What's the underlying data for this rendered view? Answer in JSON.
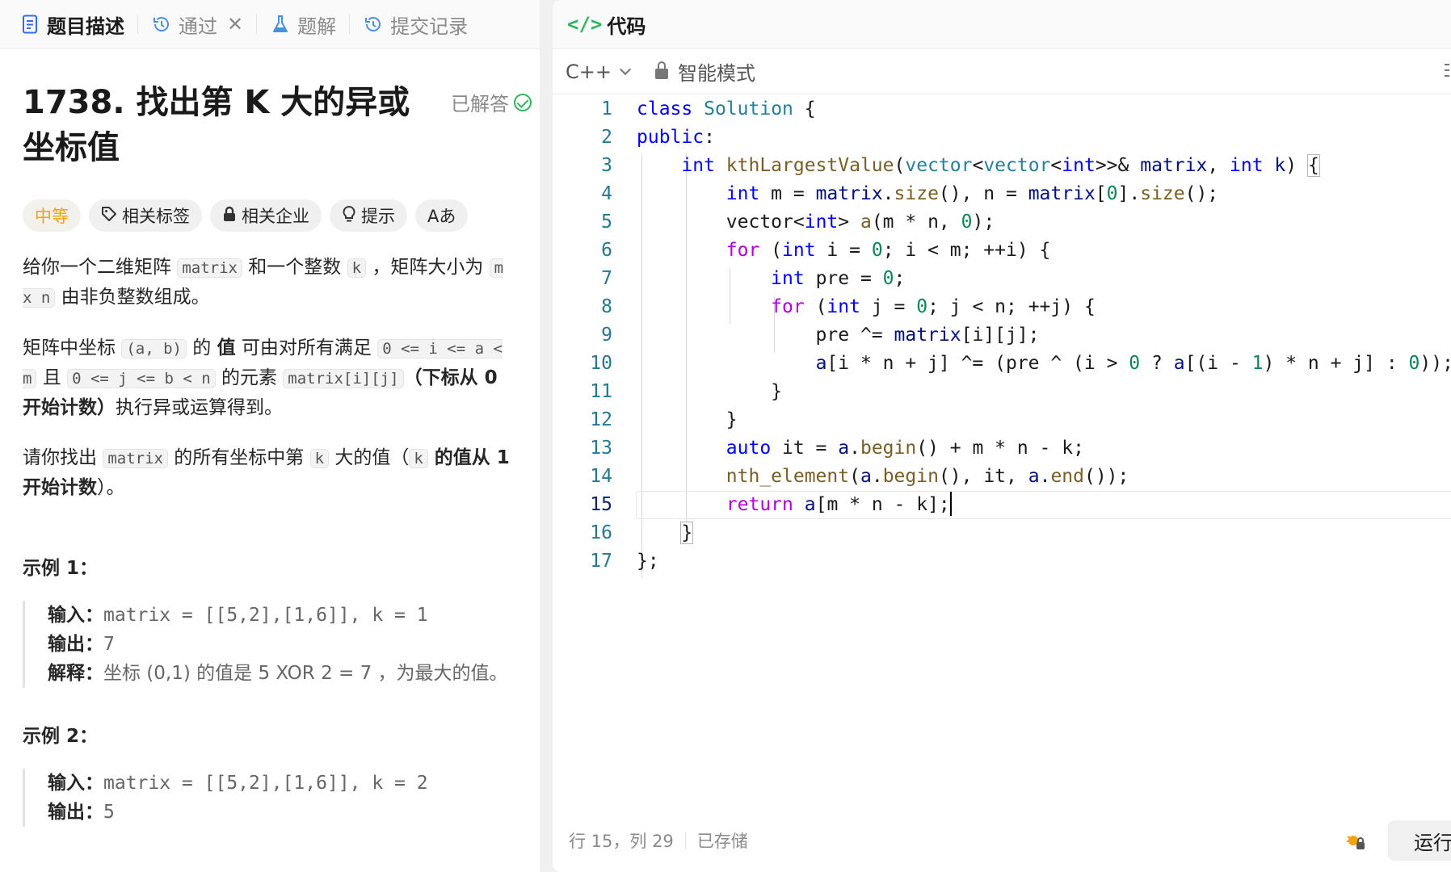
{
  "left_tabs": {
    "description": "题目描述",
    "accepted": "通过",
    "solutions": "题解",
    "submissions": "提交记录"
  },
  "problem": {
    "title": "1738. 找出第 K 大的异或坐标值",
    "status": "已解答",
    "tags": {
      "difficulty": "中等",
      "related_tags": "相关标签",
      "companies": "相关企业",
      "hint": "提示",
      "font": "Aあ"
    },
    "p1": {
      "t1": "给你一个二维矩阵 ",
      "c1": "matrix",
      "t2": " 和一个整数 ",
      "c2": "k",
      "t3": " ，矩阵大小为 ",
      "c3": "m x n",
      "t4": " 由非负整数组成。"
    },
    "p2": {
      "t1": "矩阵中坐标 ",
      "c1": "(a, b)",
      "t2": " 的 ",
      "b1": "值",
      "t3": " 可由对所有满足 ",
      "c2": "0 <= i <= a < m",
      "t4": " 且 ",
      "c3": "0 <= j <= b < n",
      "t5": " 的元素 ",
      "c4": "matrix[i][j]",
      "b2": "（下标从 0 开始计数）",
      "t6": "执行异或运算得到。"
    },
    "p3": {
      "t1": "请你找出 ",
      "c1": "matrix",
      "t2": " 的所有坐标中第 ",
      "c2": "k",
      "t3": " 大的值（",
      "c3": "k",
      "b1": " 的值从 1 开始计数",
      "t4": "）。"
    },
    "example1": {
      "title": "示例 1：",
      "input_label": "输入：",
      "input": "matrix = [[5,2],[1,6]], k = 1",
      "output_label": "输出：",
      "output": "7",
      "explain_label": "解释：",
      "explain": "坐标 (0,1) 的值是 5 XOR 2 = 7 ，为最大的值。"
    },
    "example2": {
      "title": "示例 2：",
      "input_label": "输入：",
      "input": "matrix = [[5,2],[1,6]], k = 2",
      "output_label": "输出：",
      "output": "5"
    }
  },
  "code_panel": {
    "title": "代码",
    "language": "C++",
    "mode": "智能模式",
    "line_numbers": [
      "1",
      "2",
      "3",
      "4",
      "5",
      "6",
      "7",
      "8",
      "9",
      "10",
      "11",
      "12",
      "13",
      "14",
      "15",
      "16",
      "17"
    ],
    "status_position": "行 15，列 29",
    "status_saved": "已存储",
    "run_label": "运行"
  },
  "colors": {
    "keyword_blue": "#0000ff",
    "keyword_purple": "#af00db",
    "type_teal": "#267f99",
    "function": "#795e26",
    "variable": "#001080",
    "number": "#098658",
    "accent_green": "#2db55d",
    "difficulty_medium": "#f2a20a"
  }
}
